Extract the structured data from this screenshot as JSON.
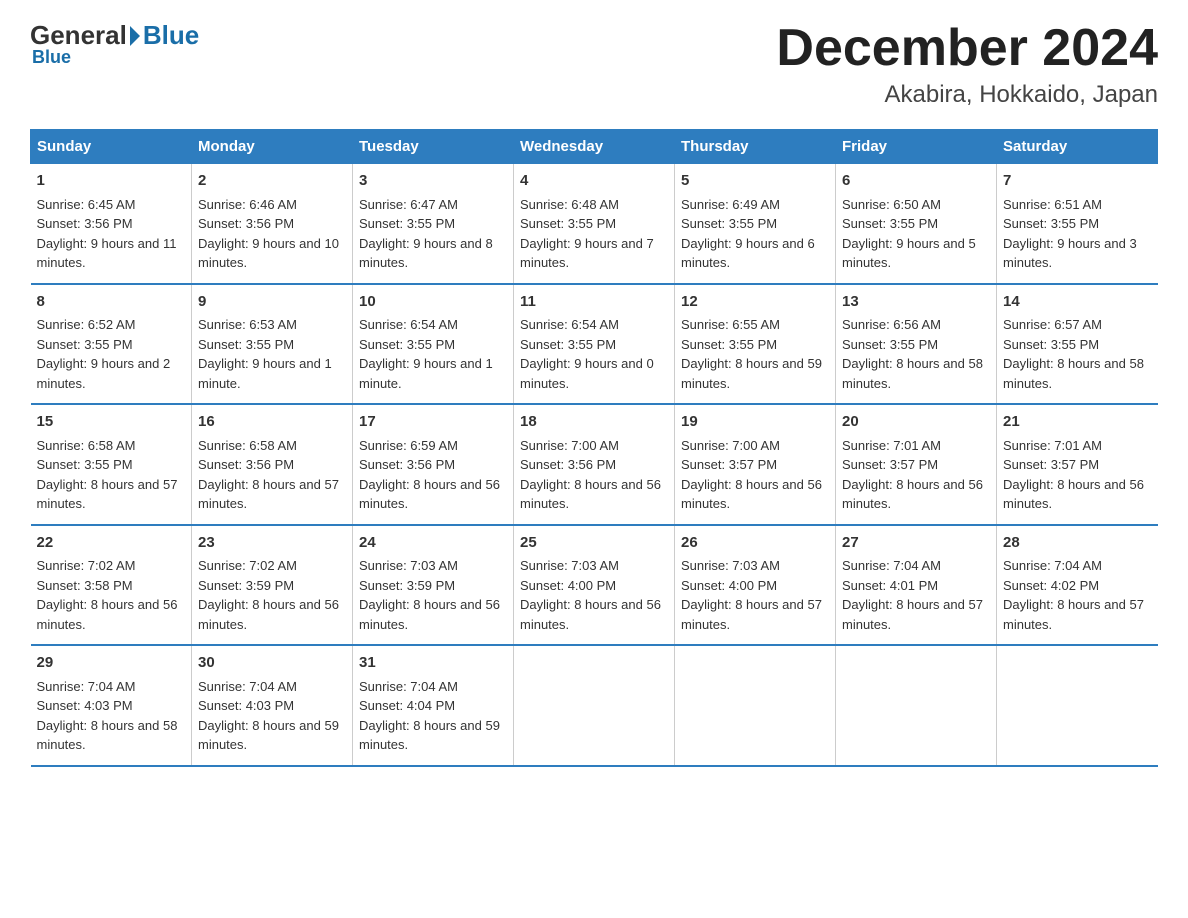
{
  "header": {
    "logo_general": "General",
    "logo_blue": "Blue",
    "month_title": "December 2024",
    "location": "Akabira, Hokkaido, Japan"
  },
  "days_of_week": [
    "Sunday",
    "Monday",
    "Tuesday",
    "Wednesday",
    "Thursday",
    "Friday",
    "Saturday"
  ],
  "weeks": [
    [
      {
        "day": "1",
        "sunrise": "Sunrise: 6:45 AM",
        "sunset": "Sunset: 3:56 PM",
        "daylight": "Daylight: 9 hours and 11 minutes."
      },
      {
        "day": "2",
        "sunrise": "Sunrise: 6:46 AM",
        "sunset": "Sunset: 3:56 PM",
        "daylight": "Daylight: 9 hours and 10 minutes."
      },
      {
        "day": "3",
        "sunrise": "Sunrise: 6:47 AM",
        "sunset": "Sunset: 3:55 PM",
        "daylight": "Daylight: 9 hours and 8 minutes."
      },
      {
        "day": "4",
        "sunrise": "Sunrise: 6:48 AM",
        "sunset": "Sunset: 3:55 PM",
        "daylight": "Daylight: 9 hours and 7 minutes."
      },
      {
        "day": "5",
        "sunrise": "Sunrise: 6:49 AM",
        "sunset": "Sunset: 3:55 PM",
        "daylight": "Daylight: 9 hours and 6 minutes."
      },
      {
        "day": "6",
        "sunrise": "Sunrise: 6:50 AM",
        "sunset": "Sunset: 3:55 PM",
        "daylight": "Daylight: 9 hours and 5 minutes."
      },
      {
        "day": "7",
        "sunrise": "Sunrise: 6:51 AM",
        "sunset": "Sunset: 3:55 PM",
        "daylight": "Daylight: 9 hours and 3 minutes."
      }
    ],
    [
      {
        "day": "8",
        "sunrise": "Sunrise: 6:52 AM",
        "sunset": "Sunset: 3:55 PM",
        "daylight": "Daylight: 9 hours and 2 minutes."
      },
      {
        "day": "9",
        "sunrise": "Sunrise: 6:53 AM",
        "sunset": "Sunset: 3:55 PM",
        "daylight": "Daylight: 9 hours and 1 minute."
      },
      {
        "day": "10",
        "sunrise": "Sunrise: 6:54 AM",
        "sunset": "Sunset: 3:55 PM",
        "daylight": "Daylight: 9 hours and 1 minute."
      },
      {
        "day": "11",
        "sunrise": "Sunrise: 6:54 AM",
        "sunset": "Sunset: 3:55 PM",
        "daylight": "Daylight: 9 hours and 0 minutes."
      },
      {
        "day": "12",
        "sunrise": "Sunrise: 6:55 AM",
        "sunset": "Sunset: 3:55 PM",
        "daylight": "Daylight: 8 hours and 59 minutes."
      },
      {
        "day": "13",
        "sunrise": "Sunrise: 6:56 AM",
        "sunset": "Sunset: 3:55 PM",
        "daylight": "Daylight: 8 hours and 58 minutes."
      },
      {
        "day": "14",
        "sunrise": "Sunrise: 6:57 AM",
        "sunset": "Sunset: 3:55 PM",
        "daylight": "Daylight: 8 hours and 58 minutes."
      }
    ],
    [
      {
        "day": "15",
        "sunrise": "Sunrise: 6:58 AM",
        "sunset": "Sunset: 3:55 PM",
        "daylight": "Daylight: 8 hours and 57 minutes."
      },
      {
        "day": "16",
        "sunrise": "Sunrise: 6:58 AM",
        "sunset": "Sunset: 3:56 PM",
        "daylight": "Daylight: 8 hours and 57 minutes."
      },
      {
        "day": "17",
        "sunrise": "Sunrise: 6:59 AM",
        "sunset": "Sunset: 3:56 PM",
        "daylight": "Daylight: 8 hours and 56 minutes."
      },
      {
        "day": "18",
        "sunrise": "Sunrise: 7:00 AM",
        "sunset": "Sunset: 3:56 PM",
        "daylight": "Daylight: 8 hours and 56 minutes."
      },
      {
        "day": "19",
        "sunrise": "Sunrise: 7:00 AM",
        "sunset": "Sunset: 3:57 PM",
        "daylight": "Daylight: 8 hours and 56 minutes."
      },
      {
        "day": "20",
        "sunrise": "Sunrise: 7:01 AM",
        "sunset": "Sunset: 3:57 PM",
        "daylight": "Daylight: 8 hours and 56 minutes."
      },
      {
        "day": "21",
        "sunrise": "Sunrise: 7:01 AM",
        "sunset": "Sunset: 3:57 PM",
        "daylight": "Daylight: 8 hours and 56 minutes."
      }
    ],
    [
      {
        "day": "22",
        "sunrise": "Sunrise: 7:02 AM",
        "sunset": "Sunset: 3:58 PM",
        "daylight": "Daylight: 8 hours and 56 minutes."
      },
      {
        "day": "23",
        "sunrise": "Sunrise: 7:02 AM",
        "sunset": "Sunset: 3:59 PM",
        "daylight": "Daylight: 8 hours and 56 minutes."
      },
      {
        "day": "24",
        "sunrise": "Sunrise: 7:03 AM",
        "sunset": "Sunset: 3:59 PM",
        "daylight": "Daylight: 8 hours and 56 minutes."
      },
      {
        "day": "25",
        "sunrise": "Sunrise: 7:03 AM",
        "sunset": "Sunset: 4:00 PM",
        "daylight": "Daylight: 8 hours and 56 minutes."
      },
      {
        "day": "26",
        "sunrise": "Sunrise: 7:03 AM",
        "sunset": "Sunset: 4:00 PM",
        "daylight": "Daylight: 8 hours and 57 minutes."
      },
      {
        "day": "27",
        "sunrise": "Sunrise: 7:04 AM",
        "sunset": "Sunset: 4:01 PM",
        "daylight": "Daylight: 8 hours and 57 minutes."
      },
      {
        "day": "28",
        "sunrise": "Sunrise: 7:04 AM",
        "sunset": "Sunset: 4:02 PM",
        "daylight": "Daylight: 8 hours and 57 minutes."
      }
    ],
    [
      {
        "day": "29",
        "sunrise": "Sunrise: 7:04 AM",
        "sunset": "Sunset: 4:03 PM",
        "daylight": "Daylight: 8 hours and 58 minutes."
      },
      {
        "day": "30",
        "sunrise": "Sunrise: 7:04 AM",
        "sunset": "Sunset: 4:03 PM",
        "daylight": "Daylight: 8 hours and 59 minutes."
      },
      {
        "day": "31",
        "sunrise": "Sunrise: 7:04 AM",
        "sunset": "Sunset: 4:04 PM",
        "daylight": "Daylight: 8 hours and 59 minutes."
      },
      {
        "day": "",
        "sunrise": "",
        "sunset": "",
        "daylight": ""
      },
      {
        "day": "",
        "sunrise": "",
        "sunset": "",
        "daylight": ""
      },
      {
        "day": "",
        "sunrise": "",
        "sunset": "",
        "daylight": ""
      },
      {
        "day": "",
        "sunrise": "",
        "sunset": "",
        "daylight": ""
      }
    ]
  ]
}
